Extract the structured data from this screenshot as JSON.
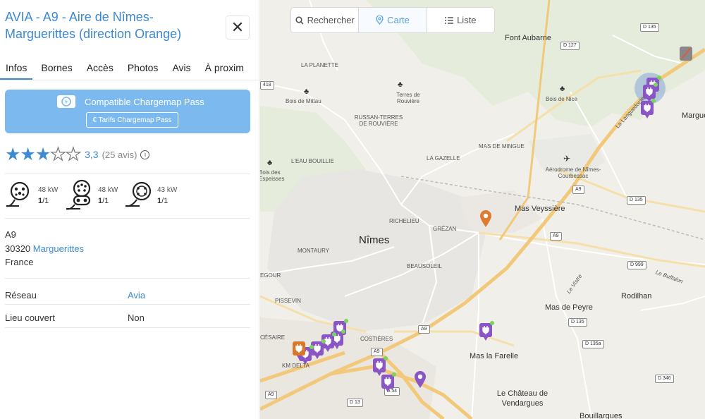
{
  "station": {
    "title": "AVIA - A9 - Aire de Nîmes-Marguerittes (direction Orange)",
    "close_label": "✕"
  },
  "tabs": [
    "Infos",
    "Bornes",
    "Accès",
    "Photos",
    "Avis",
    "À proxim"
  ],
  "pass": {
    "label": "Compatible Chargemap Pass",
    "tariff_button": "€  Tarifs Chargemap Pass"
  },
  "rating": {
    "stars_full": 3,
    "stars_total": 5,
    "value": "3,3",
    "count": "(25 avis)"
  },
  "connectors": [
    {
      "icon": "type2-socket-icon",
      "power": "48 kW",
      "available": "1",
      "total": "/1"
    },
    {
      "icon": "ccs-combo-icon",
      "power": "48 kW",
      "available": "1",
      "total": "/1"
    },
    {
      "icon": "chademo-icon",
      "power": "43 kW",
      "available": "1",
      "total": "/1"
    }
  ],
  "address": {
    "line1": "A9",
    "postcode": "30320",
    "city": "Marguerittes",
    "country": "France"
  },
  "details": [
    {
      "label": "Réseau",
      "value": "Avia",
      "link": true
    },
    {
      "label": "Lieu couvert",
      "value": "Non",
      "link": false
    }
  ],
  "map_controls": {
    "search": "Rechercher",
    "map": "Carte",
    "list": "Liste"
  },
  "map_labels": {
    "places": [
      "Font Aubarne",
      "LA PLANETTE",
      "Terres de Rouvière",
      "Bois de Mittau",
      "Bois de Nice",
      "RUSSAN-TERRES DE ROUVIÈRE",
      "MAS DE MINGUE",
      "LA GAZELLE",
      "L'EAU BOUILLIE",
      "Bois des Espeisses",
      "Aérodrome de Nîmes-Courbessac",
      "Mas Veyssière",
      "RICHELIEU",
      "GRÉZAN",
      "Nîmes",
      "MONTAURY",
      "BEAUSOLEIL",
      "EGOUR",
      "PISSEVIN",
      "Mas de Peyre",
      "Rodilhan",
      "CÉSAIRE",
      "COSTIÈRES",
      "KM DELTA",
      "Mas la Farelle",
      "Le Château de Vendargues",
      "Bouillargues",
      "Margue",
      "La Languedocienne",
      "Le Buffalon",
      "Le Vistre"
    ],
    "roads": [
      "D 135",
      "D 127",
      "418",
      "A9",
      "D 135",
      "A9",
      "D 999",
      "D 135",
      "D 135a",
      "A9",
      "A9",
      "D 346",
      "A9",
      "A 54",
      "D 13",
      "A9"
    ]
  },
  "colors": {
    "accent": "#3d8ad1",
    "pass_bg": "#7cb9ee",
    "marker": "#8a55c4",
    "marker_available": "#7ad35a",
    "highway": "#f2c97b",
    "selected_pin": "#e07a2e"
  }
}
